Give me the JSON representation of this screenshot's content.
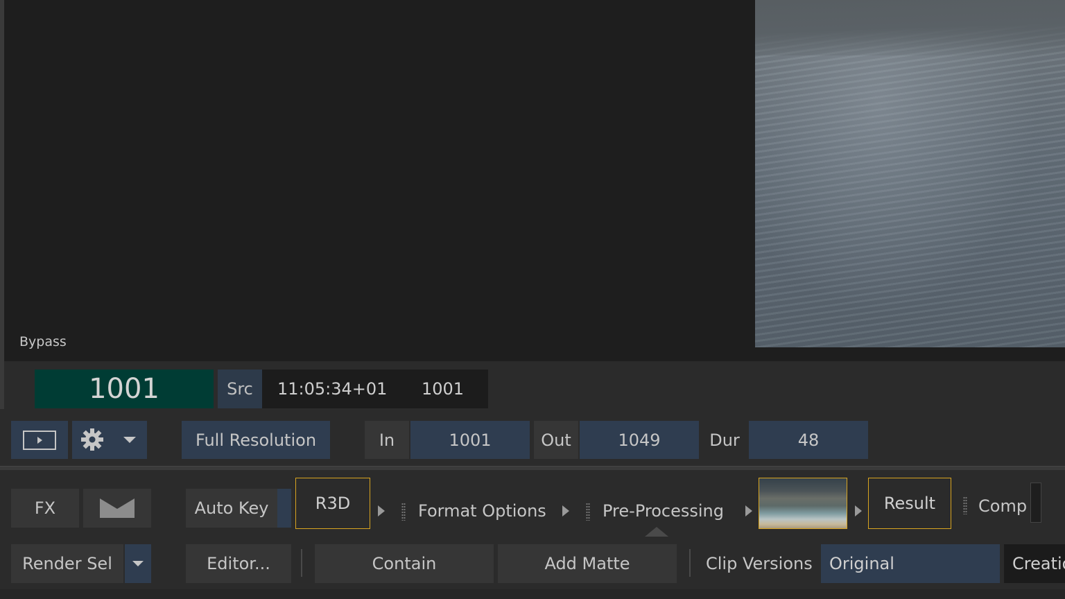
{
  "viewer": {
    "mode_label": "Bypass"
  },
  "timecode": {
    "current_frame": "1001",
    "source_label": "Src",
    "timecode": "11:05:34+01",
    "source_frame": "1001"
  },
  "toolbar": {
    "resolution": "Full Resolution",
    "in_label": "In",
    "in_value": "1001",
    "out_label": "Out",
    "out_value": "1049",
    "dur_label": "Dur",
    "dur_value": "48"
  },
  "pipeline": {
    "fx_label": "FX",
    "auto_key_label": "Auto Key",
    "nodes": [
      "R3D",
      "Format Options",
      "Pre-Processing",
      "Result",
      "Comp"
    ]
  },
  "actions": {
    "render_label": "Render Sel",
    "editor_label": "Editor...",
    "contain_label": "Contain",
    "add_matte_label": "Add Matte",
    "clip_versions_label": "Clip Versions",
    "clip_version_value": "Original",
    "creation_label": "Creation"
  },
  "colors": {
    "accent_selected": "#d9a520",
    "frame_counter_bg": "#003c34",
    "blue_button": "#2f3d50"
  }
}
